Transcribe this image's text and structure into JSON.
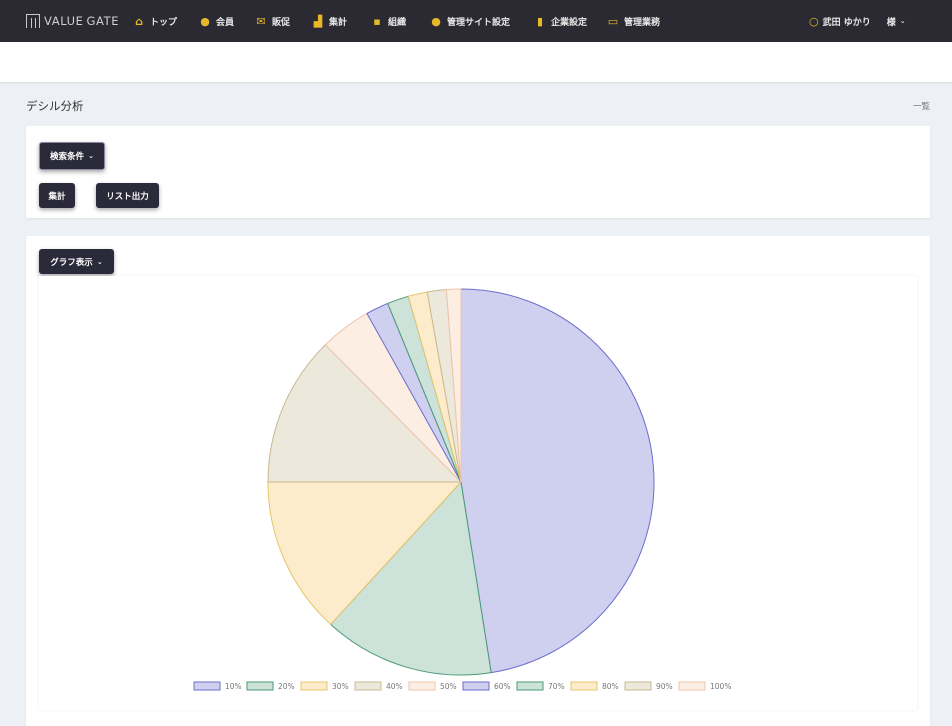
{
  "brand": {
    "part1": "VALUE",
    "part2": "GATE"
  },
  "nav": [
    {
      "label": "トップ",
      "icon": "home-icon"
    },
    {
      "label": "会員",
      "icon": "person-icon"
    },
    {
      "label": "販促",
      "icon": "envelope-icon"
    },
    {
      "label": "集計",
      "icon": "chart-icon"
    },
    {
      "label": "組織",
      "icon": "org-icon"
    },
    {
      "label": "管理サイト設定",
      "icon": "user-gear-icon"
    },
    {
      "label": "企業設定",
      "icon": "building-icon"
    },
    {
      "label": "管理業務",
      "icon": "monitor-icon"
    }
  ],
  "user": {
    "name": "武田 ゆかり",
    "suffix": "様",
    "icon": "person-outline-icon"
  },
  "page": {
    "title": "デシル分析",
    "list_link": "一覧"
  },
  "search": {
    "conditions_label": "検索条件",
    "aggregate_label": "集計",
    "list_output_label": "リスト出力"
  },
  "graph": {
    "toggle_label": "グラフ表示"
  },
  "chart_data": {
    "type": "pie",
    "categories": [
      "10%",
      "20%",
      "30%",
      "40%",
      "50%",
      "60%",
      "70%",
      "80%",
      "90%",
      "100%"
    ],
    "values": [
      47.5,
      14.3,
      13.2,
      12.6,
      4.3,
      1.9,
      1.8,
      1.6,
      1.6,
      1.2
    ],
    "legend_position": "bottom",
    "colors": {
      "fill": [
        "#cfd0f0",
        "#cde3d9",
        "#fdeccb",
        "#ece8dc",
        "#fdeee4",
        "#cfd0f0",
        "#cde3d9",
        "#fdeccb",
        "#ece8dc",
        "#fdeee4"
      ],
      "stroke": [
        "#6d6dcc",
        "#4a9a77",
        "#e6c56a",
        "#c9b98e",
        "#eec5aa",
        "#6d6dcc",
        "#4a9a77",
        "#e6c56a",
        "#c9b98e",
        "#eec5aa"
      ]
    }
  }
}
